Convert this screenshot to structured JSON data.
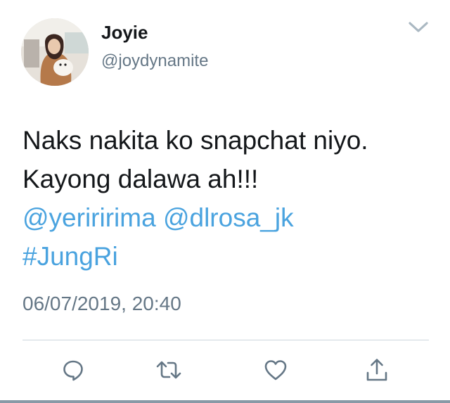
{
  "user": {
    "display_name": "Joyie",
    "handle": "@joydynamite"
  },
  "tweet": {
    "text_line1": "Naks nakita ko snapchat niyo.",
    "text_line2": "Kayong dalawa ah!!!",
    "mention1": "@yeriririma",
    "mention2": "@dlrosa_jk",
    "hashtag": "#JungRi",
    "timestamp": "06/07/2019, 20:40"
  },
  "icons": {
    "more": "chevron-down-icon",
    "reply": "reply-icon",
    "retweet": "retweet-icon",
    "like": "heart-icon",
    "share": "share-icon"
  },
  "colors": {
    "link": "#4aa3df",
    "secondary_text": "#657786",
    "primary_text": "#14171a",
    "icon": "#657786",
    "divider": "#ccd6dd"
  }
}
